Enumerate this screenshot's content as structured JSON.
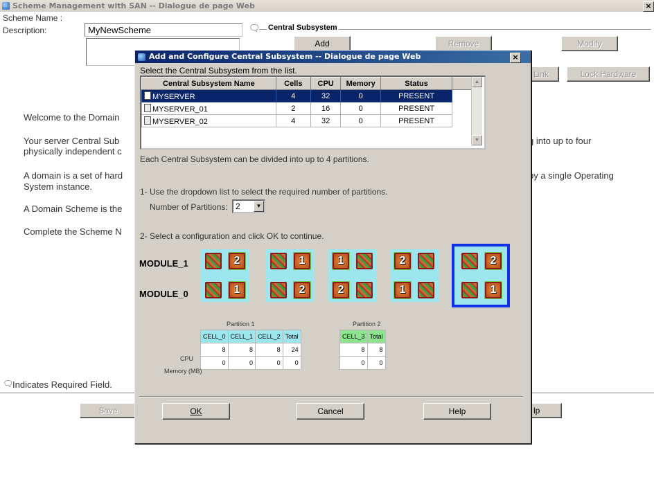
{
  "outer": {
    "title": "Scheme Management with SAN -- Dialogue de page Web",
    "scheme_name_label": "Scheme Name :",
    "scheme_name_value": "MyNewScheme",
    "description_label": "Description:",
    "central_subsystem_group": "Central Subsystem",
    "add_label": "Add",
    "remove_label": "Remove",
    "modify_label": "Modify",
    "unlink_label": "Link",
    "lock_hardware_label": "Lock Hardware",
    "welcome_text": "Welcome to the Domain",
    "p2_left": "Your server Central Sub",
    "p2_left2": "physically independent c",
    "p2_right": "g into up to four",
    "p3_left": "A domain is a set of hard",
    "p3_left2": "System instance.",
    "p3_right": "by a single Operating",
    "p4_left": "A Domain Scheme is the",
    "p5_left": "Complete the Scheme N",
    "required_note": "Indicates Required Field.",
    "save_label": "Save",
    "help_partial": "lp"
  },
  "dialog": {
    "title": "Add and Configure Central Subsystem -- Dialogue de page Web",
    "select_instruction": "Select the Central Subsystem from the list.",
    "columns": [
      "Central Subsystem Name",
      "Cells",
      "CPU",
      "Memory",
      "Status"
    ],
    "rows": [
      {
        "name": "MYSERVER",
        "cells": "4",
        "cpu": "32",
        "memory": "0",
        "status": "PRESENT"
      },
      {
        "name": "MYSERVER_01",
        "cells": "2",
        "cpu": "16",
        "memory": "0",
        "status": "PRESENT"
      },
      {
        "name": "MYSERVER_02",
        "cells": "4",
        "cpu": "32",
        "memory": "0",
        "status": "PRESENT"
      }
    ],
    "partition_note": "Each Central Subsystem can be divided into up to 4 partitions.",
    "step1": "1- Use the dropdown list to select the required number of partitions.",
    "num_partitions_label": "Number of Partitions:",
    "num_partitions_value": "2",
    "step2": "2- Select a configuration and click OK to continue.",
    "module_1": "MODULE_1",
    "module_0": "MODULE_0",
    "configs": [
      {
        "top": [
          "chip",
          "2"
        ],
        "bottom": [
          "chip",
          "1"
        ]
      },
      {
        "top": [
          "chip",
          "1"
        ],
        "bottom": [
          "chip",
          "2"
        ]
      },
      {
        "top": [
          "1",
          "chip"
        ],
        "bottom": [
          "2",
          "chip"
        ]
      },
      {
        "top": [
          "2",
          "chip"
        ],
        "bottom": [
          "1",
          "chip"
        ]
      },
      {
        "top": [
          "chip",
          "2"
        ],
        "bottom": [
          "chip",
          "1"
        ]
      }
    ],
    "partition1": {
      "title": "Partition 1",
      "headers": [
        "CELL_0",
        "CELL_1",
        "CELL_2",
        "Total"
      ],
      "cpu": [
        "8",
        "8",
        "8",
        "24"
      ],
      "memory": [
        "0",
        "0",
        "0",
        "0"
      ]
    },
    "partition2": {
      "title": "Partition 2",
      "headers": [
        "CELL_3",
        "Total"
      ],
      "cpu": [
        "8",
        "8"
      ],
      "memory": [
        "0",
        "0"
      ]
    },
    "cpu_label": "CPU",
    "memory_label": "Memory (MB)",
    "ok_label": "OK",
    "cancel_label": "Cancel",
    "help_label": "Help"
  }
}
